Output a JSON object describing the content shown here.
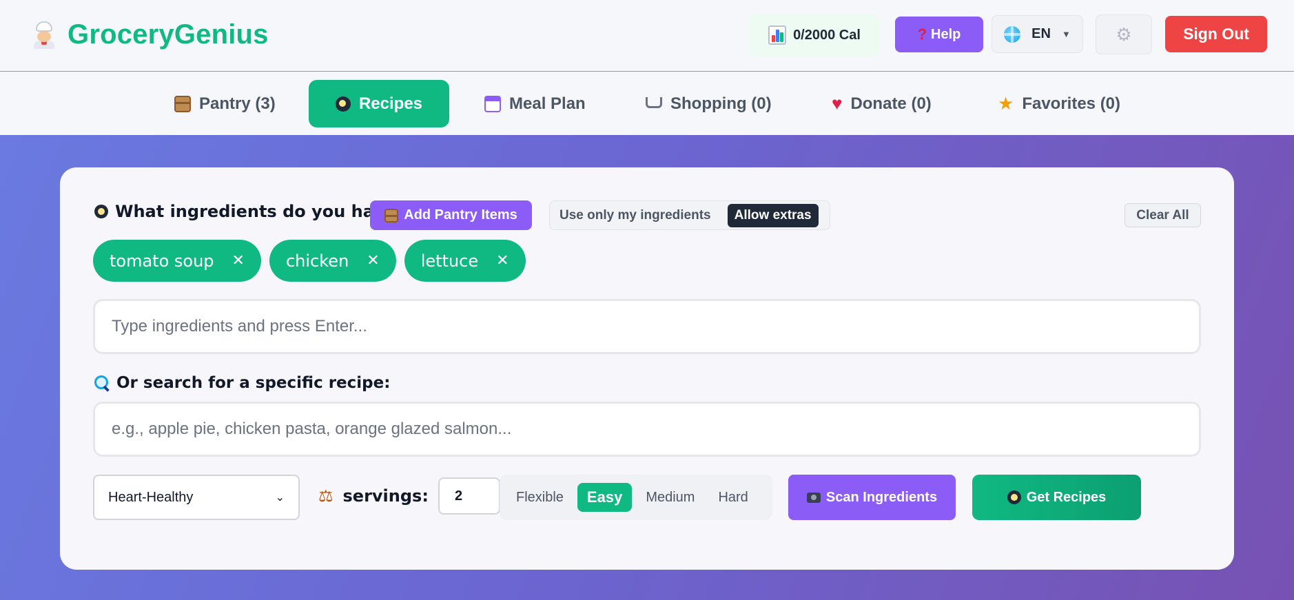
{
  "app": {
    "name": "GroceryGenius",
    "calories": "0/2000 Cal",
    "help_label": "Help",
    "language": "EN",
    "signout_label": "Sign Out"
  },
  "tabs": [
    {
      "label": "Pantry (3)",
      "icon": "box-icon",
      "active": false
    },
    {
      "label": "Recipes",
      "icon": "frying-pan-icon",
      "active": true
    },
    {
      "label": "Meal Plan",
      "icon": "calendar-icon",
      "active": false
    },
    {
      "label": "Shopping (0)",
      "icon": "cart-icon",
      "active": false
    },
    {
      "label": "Donate (0)",
      "icon": "heart-icon",
      "active": false
    },
    {
      "label": "Favorites (0)",
      "icon": "star-icon",
      "active": false
    }
  ],
  "recipes": {
    "question": "What ingredients do you have?",
    "add_pantry_label": "Add Pantry Items",
    "mode_options": [
      "Use only my ingredients",
      "Allow extras"
    ],
    "mode_selected": "Allow extras",
    "clear_all_label": "Clear All",
    "ingredients": [
      "tomato soup",
      "chicken",
      "lettuce"
    ],
    "ingredient_placeholder": "Type ingredients and press Enter...",
    "search_label": "Or search for a specific recipe:",
    "search_placeholder": "e.g., apple pie, chicken pasta, orange glazed salmon...",
    "diet_selected": "Heart-Healthy",
    "servings_label": "servings:",
    "servings_value": "2",
    "difficulty_options": [
      "Flexible",
      "Easy",
      "Medium",
      "Hard"
    ],
    "difficulty_selected": "Easy",
    "scan_label": "Scan Ingredients",
    "get_recipes_label": "Get Recipes"
  },
  "colors": {
    "brand": "#10b981",
    "accent_purple": "#8b5cf6",
    "danger": "#ef4444"
  }
}
